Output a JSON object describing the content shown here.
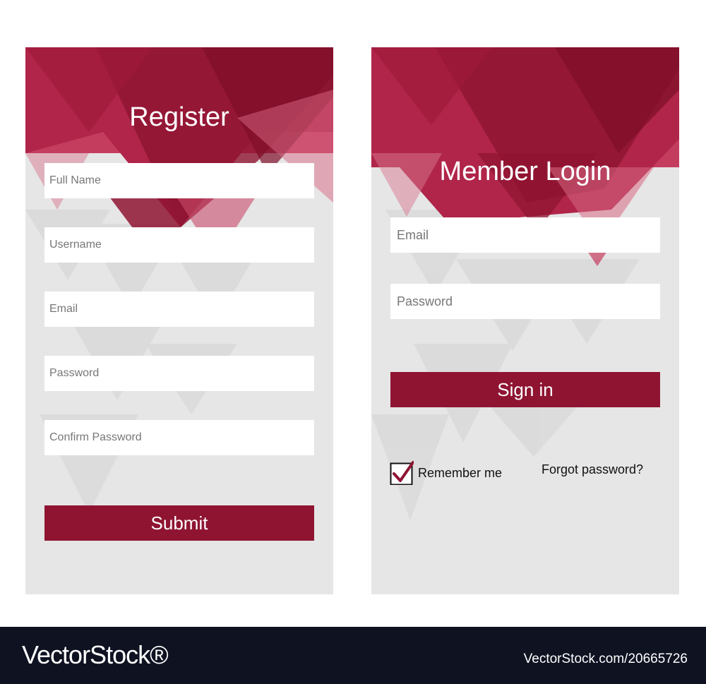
{
  "register": {
    "title": "Register",
    "fields": {
      "full_name_placeholder": "Full Name",
      "username_placeholder": "Username",
      "email_placeholder": "Email",
      "password_placeholder": "Password",
      "confirm_password_placeholder": "Confirm Password"
    },
    "submit_label": "Submit"
  },
  "login": {
    "title": "Member Login",
    "fields": {
      "email_placeholder": "Email",
      "password_placeholder": "Password"
    },
    "sign_in_label": "Sign in",
    "remember_label": "Remember me",
    "remember_checked": true,
    "forgot_label": "Forgot password?"
  },
  "footer": {
    "logo_text": "VectorStock®",
    "image_id": "VectorStock.com/20665726"
  },
  "colors": {
    "accent": "#8f1432",
    "panel_bg": "#e6e6e6",
    "footer_bg": "#0f1221"
  }
}
